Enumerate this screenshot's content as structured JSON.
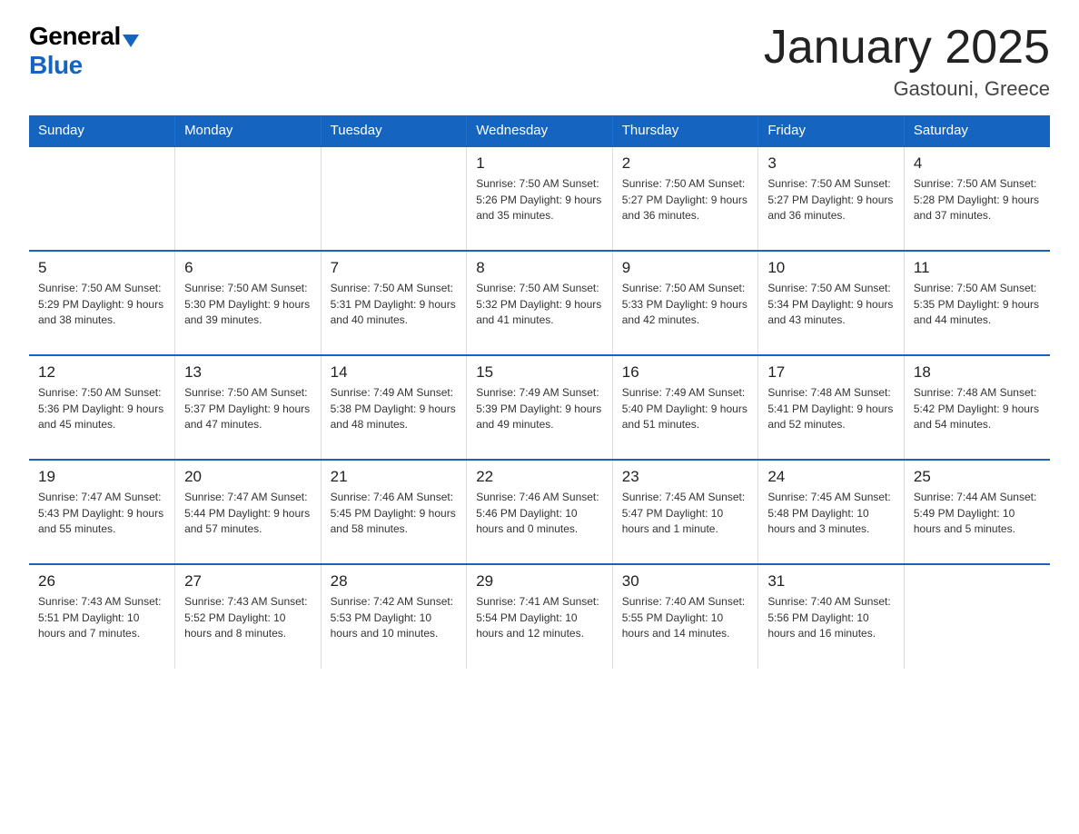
{
  "logo": {
    "general": "General",
    "blue": "Blue"
  },
  "title": "January 2025",
  "subtitle": "Gastouni, Greece",
  "headers": [
    "Sunday",
    "Monday",
    "Tuesday",
    "Wednesday",
    "Thursday",
    "Friday",
    "Saturday"
  ],
  "weeks": [
    [
      {
        "day": "",
        "info": ""
      },
      {
        "day": "",
        "info": ""
      },
      {
        "day": "",
        "info": ""
      },
      {
        "day": "1",
        "info": "Sunrise: 7:50 AM\nSunset: 5:26 PM\nDaylight: 9 hours and 35 minutes."
      },
      {
        "day": "2",
        "info": "Sunrise: 7:50 AM\nSunset: 5:27 PM\nDaylight: 9 hours and 36 minutes."
      },
      {
        "day": "3",
        "info": "Sunrise: 7:50 AM\nSunset: 5:27 PM\nDaylight: 9 hours and 36 minutes."
      },
      {
        "day": "4",
        "info": "Sunrise: 7:50 AM\nSunset: 5:28 PM\nDaylight: 9 hours and 37 minutes."
      }
    ],
    [
      {
        "day": "5",
        "info": "Sunrise: 7:50 AM\nSunset: 5:29 PM\nDaylight: 9 hours and 38 minutes."
      },
      {
        "day": "6",
        "info": "Sunrise: 7:50 AM\nSunset: 5:30 PM\nDaylight: 9 hours and 39 minutes."
      },
      {
        "day": "7",
        "info": "Sunrise: 7:50 AM\nSunset: 5:31 PM\nDaylight: 9 hours and 40 minutes."
      },
      {
        "day": "8",
        "info": "Sunrise: 7:50 AM\nSunset: 5:32 PM\nDaylight: 9 hours and 41 minutes."
      },
      {
        "day": "9",
        "info": "Sunrise: 7:50 AM\nSunset: 5:33 PM\nDaylight: 9 hours and 42 minutes."
      },
      {
        "day": "10",
        "info": "Sunrise: 7:50 AM\nSunset: 5:34 PM\nDaylight: 9 hours and 43 minutes."
      },
      {
        "day": "11",
        "info": "Sunrise: 7:50 AM\nSunset: 5:35 PM\nDaylight: 9 hours and 44 minutes."
      }
    ],
    [
      {
        "day": "12",
        "info": "Sunrise: 7:50 AM\nSunset: 5:36 PM\nDaylight: 9 hours and 45 minutes."
      },
      {
        "day": "13",
        "info": "Sunrise: 7:50 AM\nSunset: 5:37 PM\nDaylight: 9 hours and 47 minutes."
      },
      {
        "day": "14",
        "info": "Sunrise: 7:49 AM\nSunset: 5:38 PM\nDaylight: 9 hours and 48 minutes."
      },
      {
        "day": "15",
        "info": "Sunrise: 7:49 AM\nSunset: 5:39 PM\nDaylight: 9 hours and 49 minutes."
      },
      {
        "day": "16",
        "info": "Sunrise: 7:49 AM\nSunset: 5:40 PM\nDaylight: 9 hours and 51 minutes."
      },
      {
        "day": "17",
        "info": "Sunrise: 7:48 AM\nSunset: 5:41 PM\nDaylight: 9 hours and 52 minutes."
      },
      {
        "day": "18",
        "info": "Sunrise: 7:48 AM\nSunset: 5:42 PM\nDaylight: 9 hours and 54 minutes."
      }
    ],
    [
      {
        "day": "19",
        "info": "Sunrise: 7:47 AM\nSunset: 5:43 PM\nDaylight: 9 hours and 55 minutes."
      },
      {
        "day": "20",
        "info": "Sunrise: 7:47 AM\nSunset: 5:44 PM\nDaylight: 9 hours and 57 minutes."
      },
      {
        "day": "21",
        "info": "Sunrise: 7:46 AM\nSunset: 5:45 PM\nDaylight: 9 hours and 58 minutes."
      },
      {
        "day": "22",
        "info": "Sunrise: 7:46 AM\nSunset: 5:46 PM\nDaylight: 10 hours and 0 minutes."
      },
      {
        "day": "23",
        "info": "Sunrise: 7:45 AM\nSunset: 5:47 PM\nDaylight: 10 hours and 1 minute."
      },
      {
        "day": "24",
        "info": "Sunrise: 7:45 AM\nSunset: 5:48 PM\nDaylight: 10 hours and 3 minutes."
      },
      {
        "day": "25",
        "info": "Sunrise: 7:44 AM\nSunset: 5:49 PM\nDaylight: 10 hours and 5 minutes."
      }
    ],
    [
      {
        "day": "26",
        "info": "Sunrise: 7:43 AM\nSunset: 5:51 PM\nDaylight: 10 hours and 7 minutes."
      },
      {
        "day": "27",
        "info": "Sunrise: 7:43 AM\nSunset: 5:52 PM\nDaylight: 10 hours and 8 minutes."
      },
      {
        "day": "28",
        "info": "Sunrise: 7:42 AM\nSunset: 5:53 PM\nDaylight: 10 hours and 10 minutes."
      },
      {
        "day": "29",
        "info": "Sunrise: 7:41 AM\nSunset: 5:54 PM\nDaylight: 10 hours and 12 minutes."
      },
      {
        "day": "30",
        "info": "Sunrise: 7:40 AM\nSunset: 5:55 PM\nDaylight: 10 hours and 14 minutes."
      },
      {
        "day": "31",
        "info": "Sunrise: 7:40 AM\nSunset: 5:56 PM\nDaylight: 10 hours and 16 minutes."
      },
      {
        "day": "",
        "info": ""
      }
    ]
  ]
}
